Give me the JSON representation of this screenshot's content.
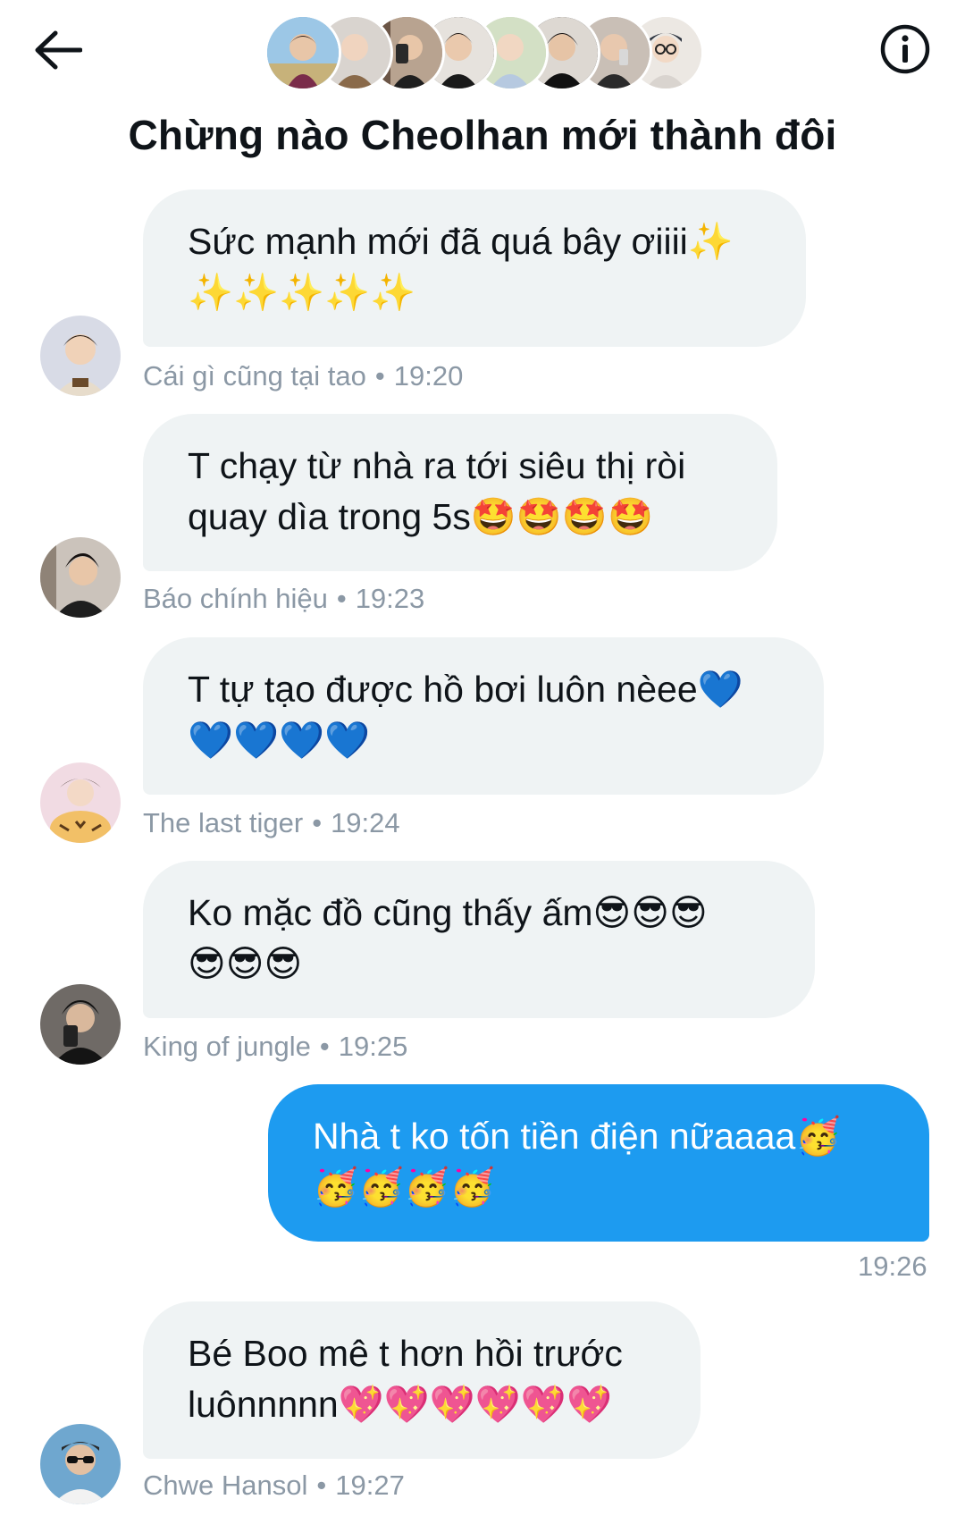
{
  "header": {
    "title": "Chừng nào Cheolhan mới thành đôi",
    "back_icon": "arrow-left-icon",
    "info_icon": "info-circle-icon",
    "participant_count": 8
  },
  "colors": {
    "bubble_incoming": "#eff3f4",
    "bubble_outgoing": "#1d9bf0",
    "meta_text": "#8b98a5"
  },
  "messages": [
    {
      "text": "Sức mạnh mới đã quá bây ơiiii✨\n✨✨✨✨✨",
      "sender": "Cái gì cũng tại tao",
      "time": "19:20",
      "mine": false
    },
    {
      "text": "T chạy từ nhà ra tới siêu thị ròi\nquay dìa trong 5s🤩🤩🤩🤩",
      "sender": "Báo chính hiệu",
      "time": "19:23",
      "mine": false
    },
    {
      "text": "T tự tạo được hồ bơi luôn nèee💙\n💙💙💙💙",
      "sender": "The last tiger",
      "time": "19:24",
      "mine": false
    },
    {
      "text": "Ko mặc đồ cũng thấy ấm😎😎😎\n😎😎😎",
      "sender": "King of jungle",
      "time": "19:25",
      "mine": false
    },
    {
      "text": "Nhà t ko tốn tiền điện nữaaaa🥳\n🥳🥳🥳🥳",
      "sender": "",
      "time": "19:26",
      "mine": true
    },
    {
      "text": "Bé Boo mê t hơn hồi trước\nluônnnnn💖💖💖💖💖💖",
      "sender": "Chwe Hansol",
      "time": "19:27",
      "mine": false
    }
  ]
}
